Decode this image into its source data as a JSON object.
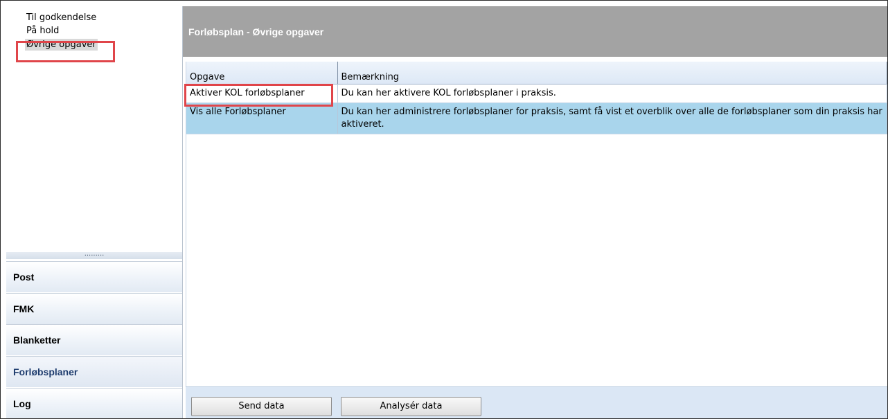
{
  "tree": {
    "items": [
      {
        "label": "Til godkendelse"
      },
      {
        "label": "På hold"
      },
      {
        "label": "Øvrige opgaver",
        "selected": true
      }
    ]
  },
  "splitter": {
    "grip": "........."
  },
  "nav": {
    "items": [
      {
        "label": "Post"
      },
      {
        "label": "FMK"
      },
      {
        "label": "Blanketter"
      },
      {
        "label": "Forløbsplaner",
        "active": true
      },
      {
        "label": "Log"
      }
    ]
  },
  "header": {
    "title": "Forløbsplan - Øvrige opgaver"
  },
  "grid": {
    "columns": [
      "Opgave",
      "Bemærkning"
    ],
    "rows": [
      {
        "task": "Aktiver KOL forløbsplaner",
        "note": "Du kan her aktivere KOL forløbsplaner i praksis."
      },
      {
        "task": "Vis alle Forløbsplaner",
        "note": "Du kan her administrere forløbsplaner for praksis, samt få vist et overblik over alle de forløbsplaner som din praksis har aktiveret."
      }
    ]
  },
  "buttons": {
    "send": "Send data",
    "analyse": "Analysér data"
  },
  "colors": {
    "header_bg": "#a3a3a3",
    "highlight": "#e0454a",
    "selected_row": "#a9d5ec",
    "active_nav_text": "#1f3d6e"
  }
}
